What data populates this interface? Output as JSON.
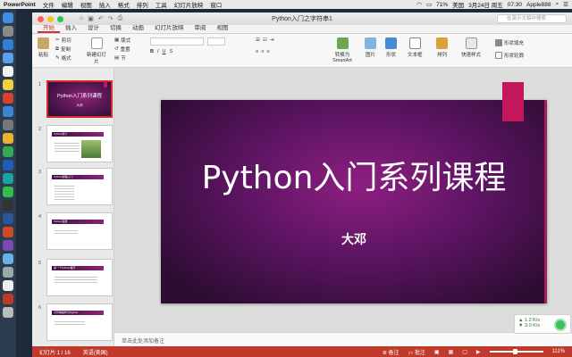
{
  "menubar": {
    "app": "PowerPoint",
    "items": [
      "文件",
      "编辑",
      "视图",
      "插入",
      "格式",
      "排列",
      "工具",
      "幻灯片放映",
      "窗口"
    ],
    "battery": "71%",
    "input": "美国",
    "date": "3月24日 周五",
    "time": "07:30",
    "user": "Apple888"
  },
  "window": {
    "title": "Python入门之字符串1",
    "search_placeholder": "在演示文稿中搜索"
  },
  "ribbon": {
    "tabs": [
      "开始",
      "插入",
      "设计",
      "切换",
      "动画",
      "幻灯片放映",
      "审阅",
      "视图"
    ],
    "active_tab": "开始",
    "paste": "粘贴",
    "cut": "剪切",
    "copy": "复制",
    "format": "格式",
    "new_slide": "新建幻灯片",
    "layout": "版式",
    "reset": "重置",
    "section": "节",
    "convert": "转换为SmartArt",
    "picture": "图片",
    "shape": "形状",
    "textbox": "文本框",
    "arrange": "排列",
    "quick_styles": "快速样式",
    "shape_fill": "形状填充",
    "shape_outline": "形状轮廓"
  },
  "thumbnails": [
    {
      "num": "1",
      "title": "Python入门系列课程",
      "sub": "大邓"
    },
    {
      "num": "2",
      "title": "Python简介"
    },
    {
      "num": "3",
      "title": "Python编程入门"
    },
    {
      "num": "4",
      "title": "Python变量"
    },
    {
      "num": "5",
      "title": "第一个Python程序"
    },
    {
      "num": "6",
      "title": "字符串操作与Python"
    }
  ],
  "slide": {
    "title": "Python入门系列课程",
    "subtitle": "大邓"
  },
  "notes_placeholder": "单击此处添加备注",
  "status": {
    "slide_count": "幻灯片 1 / 16",
    "language": "英语(美国)",
    "notes": "备注",
    "comments": "批注",
    "zoom": "111%"
  },
  "netmon": {
    "up": "1.2 K/s",
    "down": "3.0 K/s"
  }
}
